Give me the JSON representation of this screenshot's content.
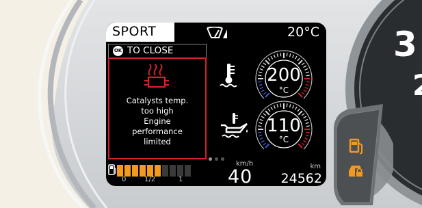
{
  "header": {
    "mode": "SPORT",
    "wiper_icon": "wiper-auto-icon",
    "outside_temp": "20°C"
  },
  "notification": {
    "close_button": "OK",
    "close_hint": "TO CLOSE",
    "warning_icon": "catalyst-temperature-icon",
    "message_lines": [
      "Catalysts temp.",
      "too high",
      "Engine",
      "performance",
      "limited"
    ],
    "accent_color": "#d4232b"
  },
  "page_dots": {
    "count": 3,
    "active_index": 0
  },
  "gauges": [
    {
      "name": "coolant",
      "icon": "coolant-temperature-icon",
      "value": "200",
      "unit": "°C"
    },
    {
      "name": "oil",
      "icon": "oil-temperature-icon",
      "value": "110",
      "unit": "°C"
    }
  ],
  "fuel": {
    "icon": "fuel-pump-icon",
    "level_fraction": 0.6,
    "scale_labels": [
      "0",
      "1/2",
      "1"
    ],
    "fill_color": "#f39a1e"
  },
  "speed": {
    "value": "40",
    "unit": "km/h"
  },
  "odometer": {
    "value": "24562",
    "unit": "km"
  },
  "tachometer": {
    "visible_digits": [
      "3",
      "2"
    ]
  },
  "side_indicators": {
    "icons": [
      "fuel-reserve-icon",
      "door-lock-icon"
    ],
    "color": "#f39a1e"
  }
}
